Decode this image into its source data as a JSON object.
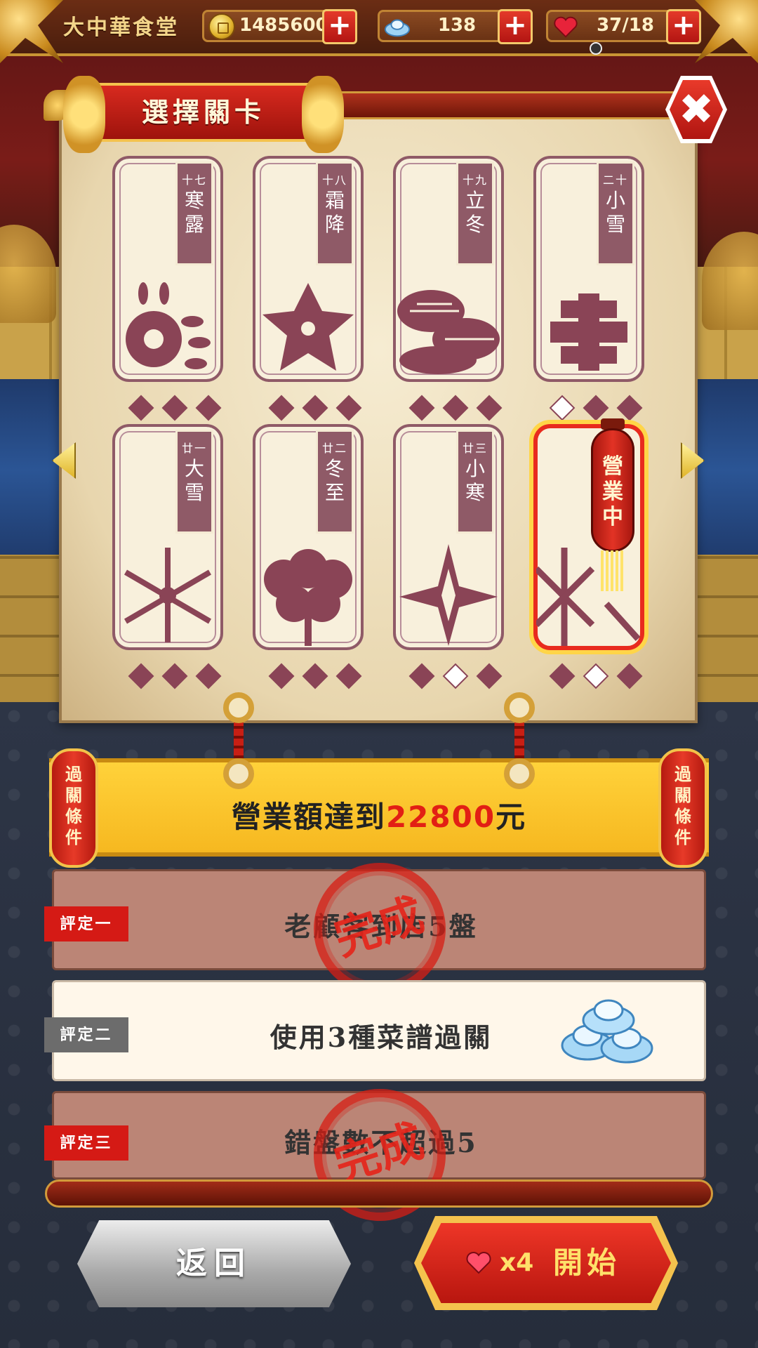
{
  "header": {
    "shop_name": "大中華食堂",
    "coins": "1485600",
    "silver": "138",
    "hearts": "37/18",
    "plus_label": "+"
  },
  "panel": {
    "title": "選擇關卡",
    "close_label": "✖"
  },
  "stages": [
    {
      "num": "十七",
      "name": "寒露",
      "stars": [
        true,
        true,
        true
      ],
      "active": false
    },
    {
      "num": "十八",
      "name": "霜降",
      "stars": [
        true,
        true,
        true
      ],
      "active": false
    },
    {
      "num": "十九",
      "name": "立冬",
      "stars": [
        true,
        true,
        true
      ],
      "active": false
    },
    {
      "num": "二十",
      "name": "小雪",
      "stars": [
        false,
        true,
        true
      ],
      "active": false
    },
    {
      "num": "廿一",
      "name": "大雪",
      "stars": [
        true,
        true,
        true
      ],
      "active": false
    },
    {
      "num": "廿二",
      "name": "冬至",
      "stars": [
        true,
        true,
        true
      ],
      "active": false
    },
    {
      "num": "廿三",
      "name": "小寒",
      "stars": [
        true,
        false,
        true
      ],
      "active": false
    },
    {
      "num": "",
      "name": "",
      "stars": [
        true,
        false,
        true
      ],
      "active": true
    }
  ],
  "lantern_text": "營業中",
  "condition": {
    "side_label": "過關條件",
    "prefix": "營業額達到",
    "goal": "22800",
    "suffix": "元"
  },
  "ratings": [
    {
      "tag": "評定一",
      "desc": "老顧客到店5盤",
      "done": true
    },
    {
      "tag": "評定二",
      "desc": "使用3種菜譜過關",
      "done": false
    },
    {
      "tag": "評定三",
      "desc": "錯盤數不超過5",
      "done": true
    }
  ],
  "stamp_text": "完成",
  "buttons": {
    "back": "返回",
    "start_cost": "x4",
    "start": "開始"
  },
  "colors": {
    "accent_red": "#e21f14",
    "gold": "#f4c24d",
    "gem": "#8a4456"
  }
}
